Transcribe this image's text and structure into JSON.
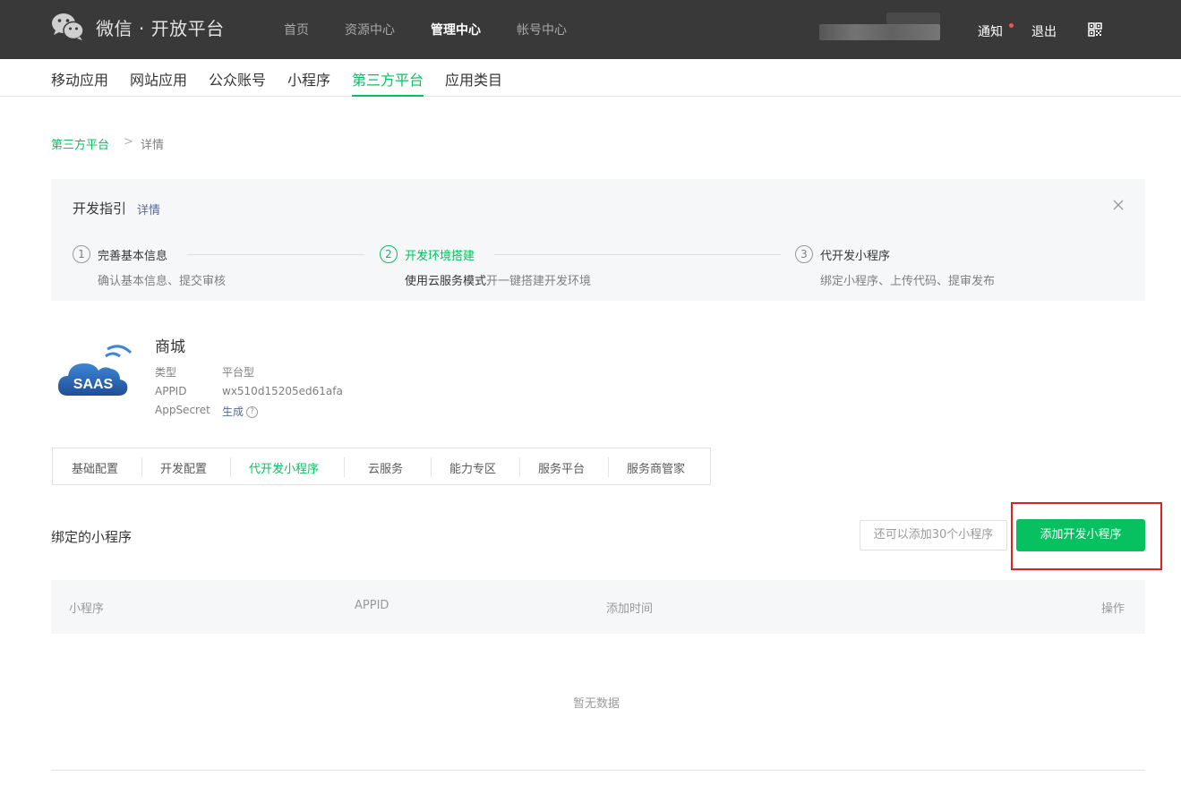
{
  "header": {
    "brand": "微信 · 开放平台",
    "nav": [
      "首页",
      "资源中心",
      "管理中心",
      "帐号中心"
    ],
    "active_nav": "管理中心",
    "notify": "通知",
    "logout": "退出"
  },
  "subnav": {
    "items": [
      "移动应用",
      "网站应用",
      "公众账号",
      "小程序",
      "第三方平台",
      "应用类目"
    ],
    "active": "第三方平台"
  },
  "breadcrumb": {
    "parent": "第三方平台",
    "separator": ">",
    "current": "详情"
  },
  "guide": {
    "title": "开发指引",
    "link": "详情",
    "steps": [
      {
        "num": "1",
        "title": "完善基本信息",
        "desc": "确认基本信息、提交审核"
      },
      {
        "num": "2",
        "title": "开发环境搭建",
        "desc_highlight": "使用云服务模式",
        "desc": "开一键搭建开发环境"
      },
      {
        "num": "3",
        "title": "代开发小程序",
        "desc": "绑定小程序、上传代码、提审发布"
      }
    ]
  },
  "app": {
    "name": "商城",
    "logo_text": "SAAS",
    "type_label": "类型",
    "type_value": "平台型",
    "appid_label": "APPID",
    "appid_value": "wx510d15205ed61afa",
    "secret_label": "AppSecret",
    "secret_value": "生成",
    "help": "?"
  },
  "tabs": {
    "items": [
      "基础配置",
      "开发配置",
      "代开发小程序",
      "云服务",
      "能力专区",
      "服务平台",
      "服务商管家"
    ],
    "active": "代开发小程序"
  },
  "bound": {
    "title": "绑定的小程序",
    "quota": "还可以添加30个小程序",
    "add_button": "添加开发小程序"
  },
  "table": {
    "columns": [
      "小程序",
      "APPID",
      "添加时间",
      "操作"
    ],
    "empty": "暂无数据"
  },
  "colors": {
    "accent": "#07c160",
    "header_bg": "#393939",
    "highlight": "#e02020",
    "link": "#576b95"
  }
}
